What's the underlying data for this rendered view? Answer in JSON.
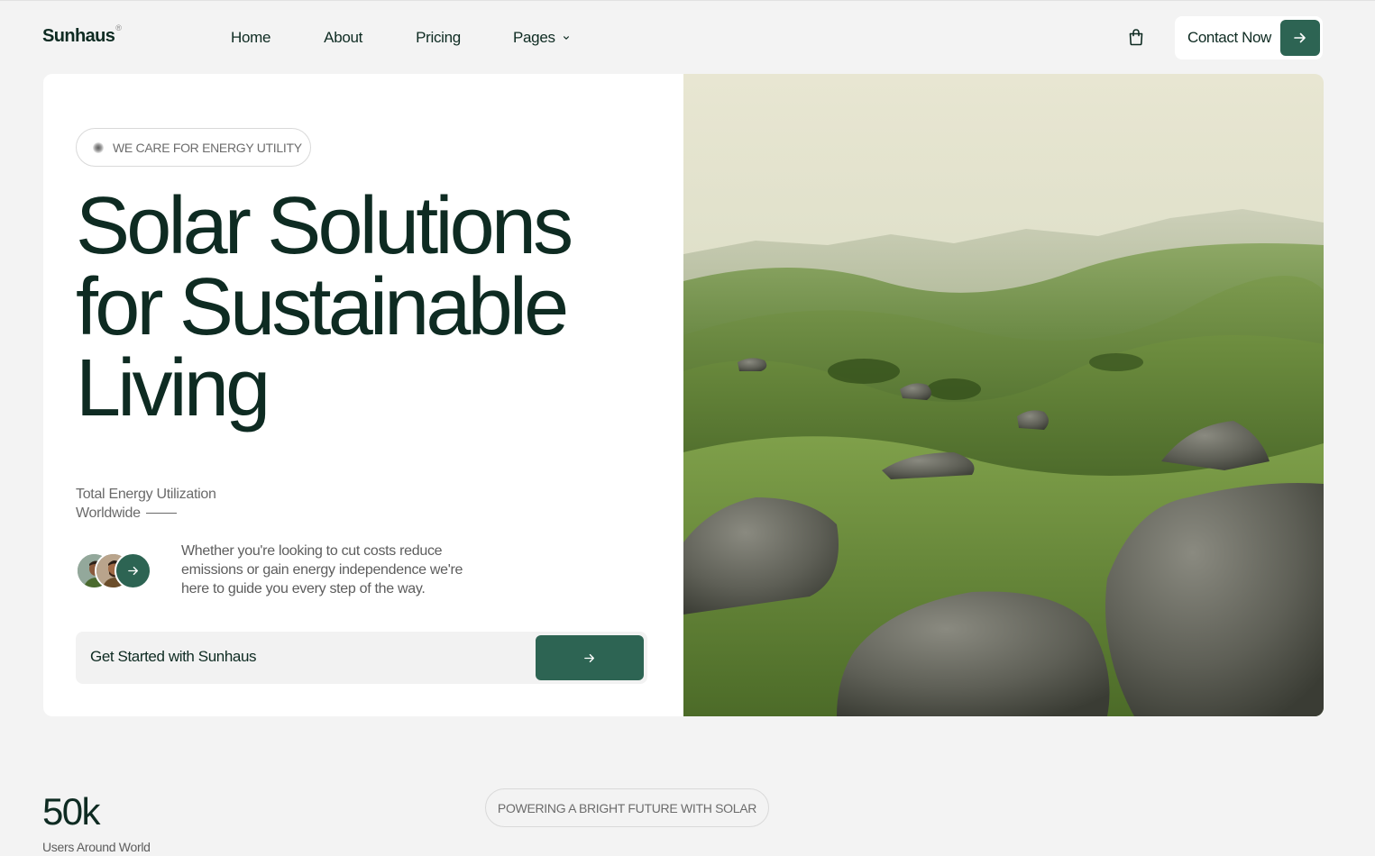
{
  "brand": {
    "name": "Sunhaus",
    "mark": "®"
  },
  "nav": {
    "items": [
      {
        "label": "Home"
      },
      {
        "label": "About"
      },
      {
        "label": "Pricing"
      },
      {
        "label": "Pages",
        "icon": "chevron-down-icon"
      }
    ],
    "cart_icon": "shopping-bag-icon",
    "contact_label": "Contact Now",
    "contact_icon": "arrow-right-icon"
  },
  "hero": {
    "badge": "WE CARE FOR ENERGY UTILITY",
    "headline_lines": [
      "Solar Solutions",
      "for Sustainable",
      "Living"
    ],
    "utilization_lines": [
      "Total Energy Utilization",
      "Worldwide"
    ],
    "description": "Whether you're looking to cut costs reduce emissions or gain energy independence we're here to guide you every step of the way.",
    "cta_label": "Get Started with Sunhaus",
    "image_alt": "Rolling green hills with mossy rocks at sunrise"
  },
  "stats": {
    "value": "50k",
    "label": "Users Around World"
  },
  "section_badge": "POWERING A BRIGHT FUTURE WITH SOLAR",
  "colors": {
    "accent": "#2d6453",
    "text_dark": "#0e2b22",
    "background": "#f3f3f3"
  }
}
